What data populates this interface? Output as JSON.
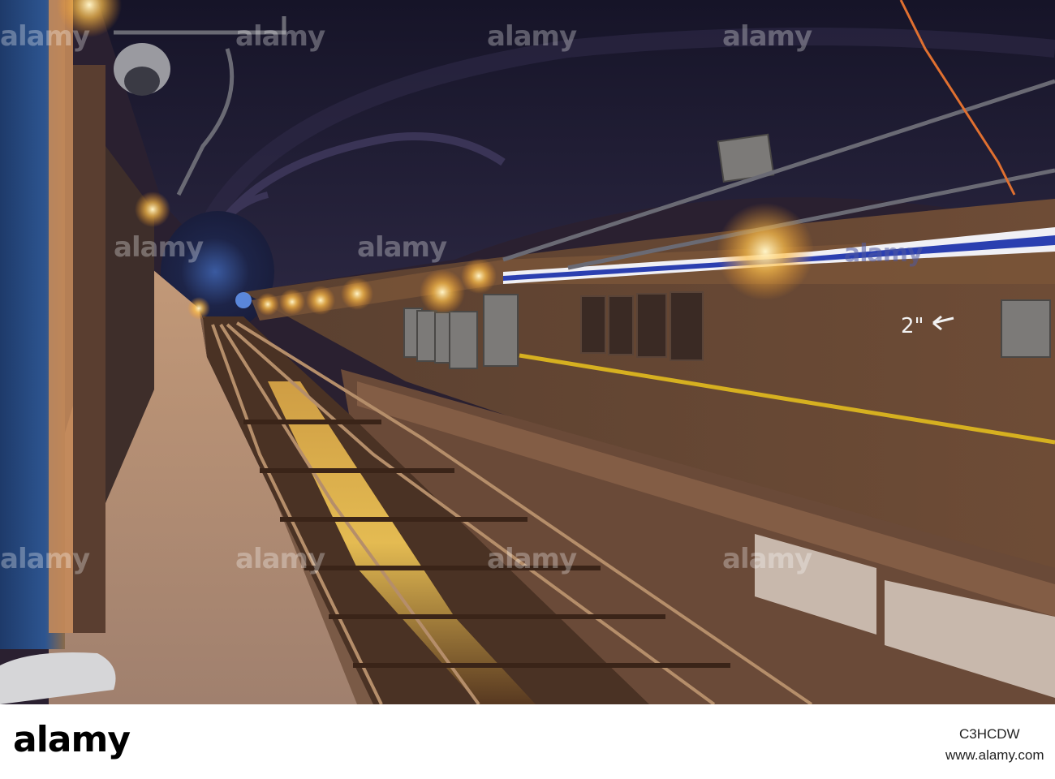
{
  "photo": {
    "subject": "subway tunnel",
    "colors": {
      "tunnel_ceiling": "#1e1c36",
      "tunnel_wall": "#6a4a34",
      "platform": "#a9826e",
      "track_bed": "#4a3224",
      "stripe_blue": "#2b3fb0",
      "light_glow": "#ffcf6a",
      "column_blue": "#2a4d8a"
    },
    "wall_marking": "2\"",
    "watermark": "alamy"
  },
  "footer": {
    "brand": "alamy",
    "stock_id": "C3HCDW",
    "url": "www.alamy.com"
  }
}
